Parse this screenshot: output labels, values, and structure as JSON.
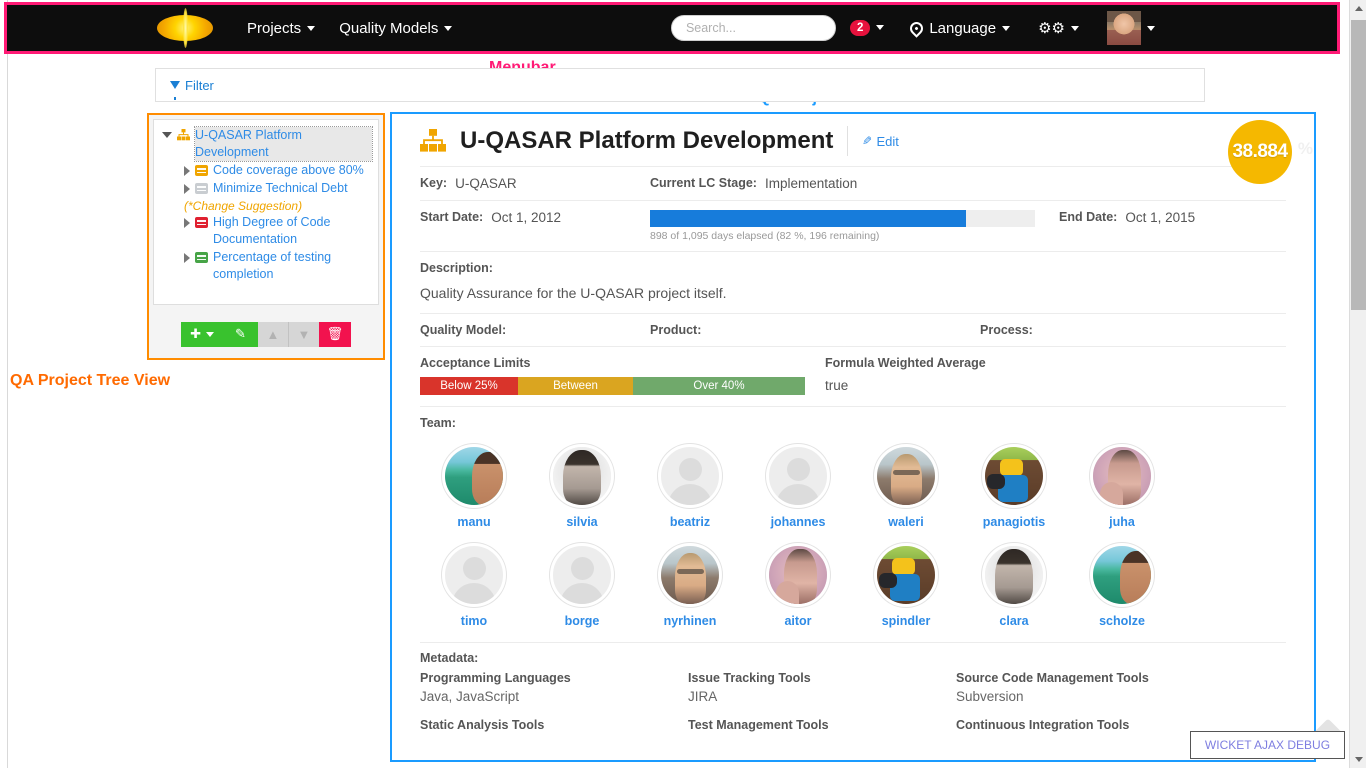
{
  "menubar": {
    "logo_icon": "uqasar-sun-logo",
    "items": [
      {
        "label": "Projects",
        "icon": "chevron-down-icon"
      },
      {
        "label": "Quality Models",
        "icon": "chevron-down-icon"
      }
    ],
    "search": {
      "placeholder": "Search...",
      "value": "",
      "icon": "search-input"
    },
    "notifications": {
      "count": "2",
      "icon": "bell-badge"
    },
    "language": {
      "label": "Language",
      "icon": "globe-icon"
    },
    "settings": {
      "icon": "gears-icon"
    },
    "user": {
      "icon": "user-avatar"
    }
  },
  "annotations": {
    "menubar": "Menubar",
    "detail_view": "QA Project Detail View",
    "tree_view": "QA Project Tree View",
    "color_menubar": "#ff1a75",
    "color_detail": "#1a9bff",
    "color_tree": "#ff6a00"
  },
  "filter": {
    "label": "Filter",
    "icon": "funnel-icon"
  },
  "tree": {
    "root": {
      "label": "U-QASAR Platform Development",
      "icon": "sitemap-icon",
      "expanded": true,
      "selected": true
    },
    "children": [
      {
        "label": "Code coverage above 80%",
        "icon": "list-icon-orange",
        "expanded": false
      },
      {
        "label": "Minimize Technical Debt",
        "icon": "list-icon-grey",
        "expanded": false,
        "note": "(*Change Suggestion)"
      },
      {
        "label": "High Degree of Code Documentation",
        "icon": "list-icon-red",
        "expanded": false
      },
      {
        "label": "Percentage of testing completion",
        "icon": "list-icon-green",
        "expanded": false
      }
    ],
    "toolbar": {
      "add": {
        "icon": "plus-icon",
        "caret": "chevron-down-icon"
      },
      "edit": {
        "icon": "pencil-icon"
      },
      "move_up": {
        "icon": "arrow-up-circle-icon",
        "disabled": true
      },
      "move_down": {
        "icon": "arrow-down-circle-icon",
        "disabled": true
      },
      "delete": {
        "icon": "trash-icon"
      }
    }
  },
  "detail": {
    "title": "U-QASAR Platform Development",
    "title_icon": "sitemap-icon",
    "edit_label": "Edit",
    "edit_icon": "pencil-icon",
    "score": {
      "value": "38.884",
      "unit": "%",
      "color": "#f5b800"
    },
    "fields": {
      "key_label": "Key:",
      "key_value": "U-QASAR",
      "lc_stage_label": "Current LC Stage:",
      "lc_stage_value": "Implementation",
      "start_date_label": "Start Date:",
      "start_date_value": "Oct 1, 2012",
      "end_date_label": "End Date:",
      "end_date_value": "Oct 1, 2015"
    },
    "progress": {
      "percent": 82,
      "caption": "898 of 1,095 days elapsed (82 %, 196 remaining)",
      "bar_color": "#177cdb"
    },
    "description_label": "Description:",
    "description_text": "Quality Assurance for the U-QASAR project itself.",
    "quality_model_label": "Quality Model:",
    "product_label": "Product:",
    "process_label": "Process:",
    "acceptance_limits_label": "Acceptance Limits",
    "acceptance_limits": [
      {
        "label": "Below 25%",
        "color": "#d9342b"
      },
      {
        "label": "Between",
        "color": "#daa520"
      },
      {
        "label": "Over 40%",
        "color": "#70a96b"
      }
    ],
    "formula_label": "Formula Weighted Average",
    "formula_value": "true",
    "team_label": "Team:",
    "team": [
      {
        "name": "manu",
        "avatar": "photo-beach-man"
      },
      {
        "name": "silvia",
        "avatar": "photo-bw-woman"
      },
      {
        "name": "beatriz",
        "avatar": "placeholder-person"
      },
      {
        "name": "johannes",
        "avatar": "placeholder-person"
      },
      {
        "name": "waleri",
        "avatar": "photo-man-glasses"
      },
      {
        "name": "panagiotis",
        "avatar": "photo-lego-figure"
      },
      {
        "name": "juha",
        "avatar": "photo-purple-man"
      },
      {
        "name": "timo",
        "avatar": "placeholder-person"
      },
      {
        "name": "borge",
        "avatar": "placeholder-person"
      },
      {
        "name": "nyrhinen",
        "avatar": "photo-man-glasses"
      },
      {
        "name": "aitor",
        "avatar": "photo-purple-man"
      },
      {
        "name": "spindler",
        "avatar": "photo-lego-figure"
      },
      {
        "name": "clara",
        "avatar": "photo-bw-woman"
      },
      {
        "name": "scholze",
        "avatar": "photo-beach-man"
      }
    ],
    "metadata_label": "Metadata:",
    "metadata": [
      {
        "key": "Programming Languages",
        "value": "Java, JavaScript"
      },
      {
        "key": "Issue Tracking Tools",
        "value": "JIRA"
      },
      {
        "key": "Source Code Management Tools",
        "value": "Subversion"
      },
      {
        "key": "Static Analysis Tools",
        "value": ""
      },
      {
        "key": "Test Management Tools",
        "value": ""
      },
      {
        "key": "Continuous Integration Tools",
        "value": ""
      }
    ]
  },
  "wicket_debug": {
    "label": "WICKET AJAX DEBUG"
  }
}
